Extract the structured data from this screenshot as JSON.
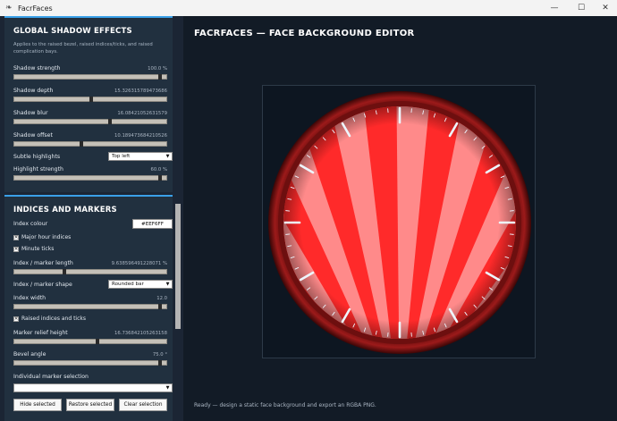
{
  "window": {
    "title": "FacrFaces",
    "minimize_glyph": "—",
    "maximize_glyph": "☐",
    "close_glyph": "✕",
    "app_icon": "feather-icon"
  },
  "shadow": {
    "header": "GLOBAL SHADOW EFFECTS",
    "description": "Applies to the raised bezel, raised indices/ticks, and raised complication bays.",
    "strength": {
      "label": "Shadow strength",
      "value": "100.0  %",
      "level": 1.0
    },
    "depth": {
      "label": "Shadow depth",
      "value": "15.326315789473686",
      "level": 0.52
    },
    "blur": {
      "label": "Shadow blur",
      "value": "16.08421052631579",
      "level": 0.65
    },
    "offset": {
      "label": "Shadow offset",
      "value": "10.189473684210526",
      "level": 0.45
    },
    "subtle": {
      "label": "Subtle highlights",
      "selected": "Top left"
    },
    "highlight": {
      "label": "Highlight strength",
      "value": "60.0  %",
      "level": 1.0
    }
  },
  "indices": {
    "header": "INDICES AND MARKERS",
    "colour_label": "Index colour",
    "colour_value": "#EEF6FF",
    "major_label": "Major hour indices",
    "minute_label": "Minute ticks",
    "length": {
      "label": "Index / marker length",
      "value": "9.638596491228071  %",
      "level": 0.33
    },
    "shape": {
      "label": "Index / marker shape",
      "selected": "Rounded bar"
    },
    "width": {
      "label": "Index width",
      "value": "12.0",
      "level": 1.0
    },
    "raised_label": "Raised indices and ticks",
    "relief": {
      "label": "Marker relief height",
      "value": "16.736842105263158",
      "level": 0.56
    },
    "bevel": {
      "label": "Bevel angle",
      "value": "75.0  °",
      "level": 1.0
    },
    "selection_label": "Individual marker selection",
    "selection_value": "",
    "btn_hide": "Hide selected",
    "btn_restore": "Restore selected",
    "btn_clear": "Clear selection"
  },
  "main": {
    "title": "FACRFACES — FACE BACKGROUND EDITOR",
    "status": "Ready — design a static face background and export an RGBA PNG."
  },
  "colors": {
    "accent": "#3aa0e8",
    "ray_dark": "#ff2a2a",
    "ray_light": "#ff8a8a",
    "bezel": "#8f1515",
    "index": "#eef6ff"
  }
}
